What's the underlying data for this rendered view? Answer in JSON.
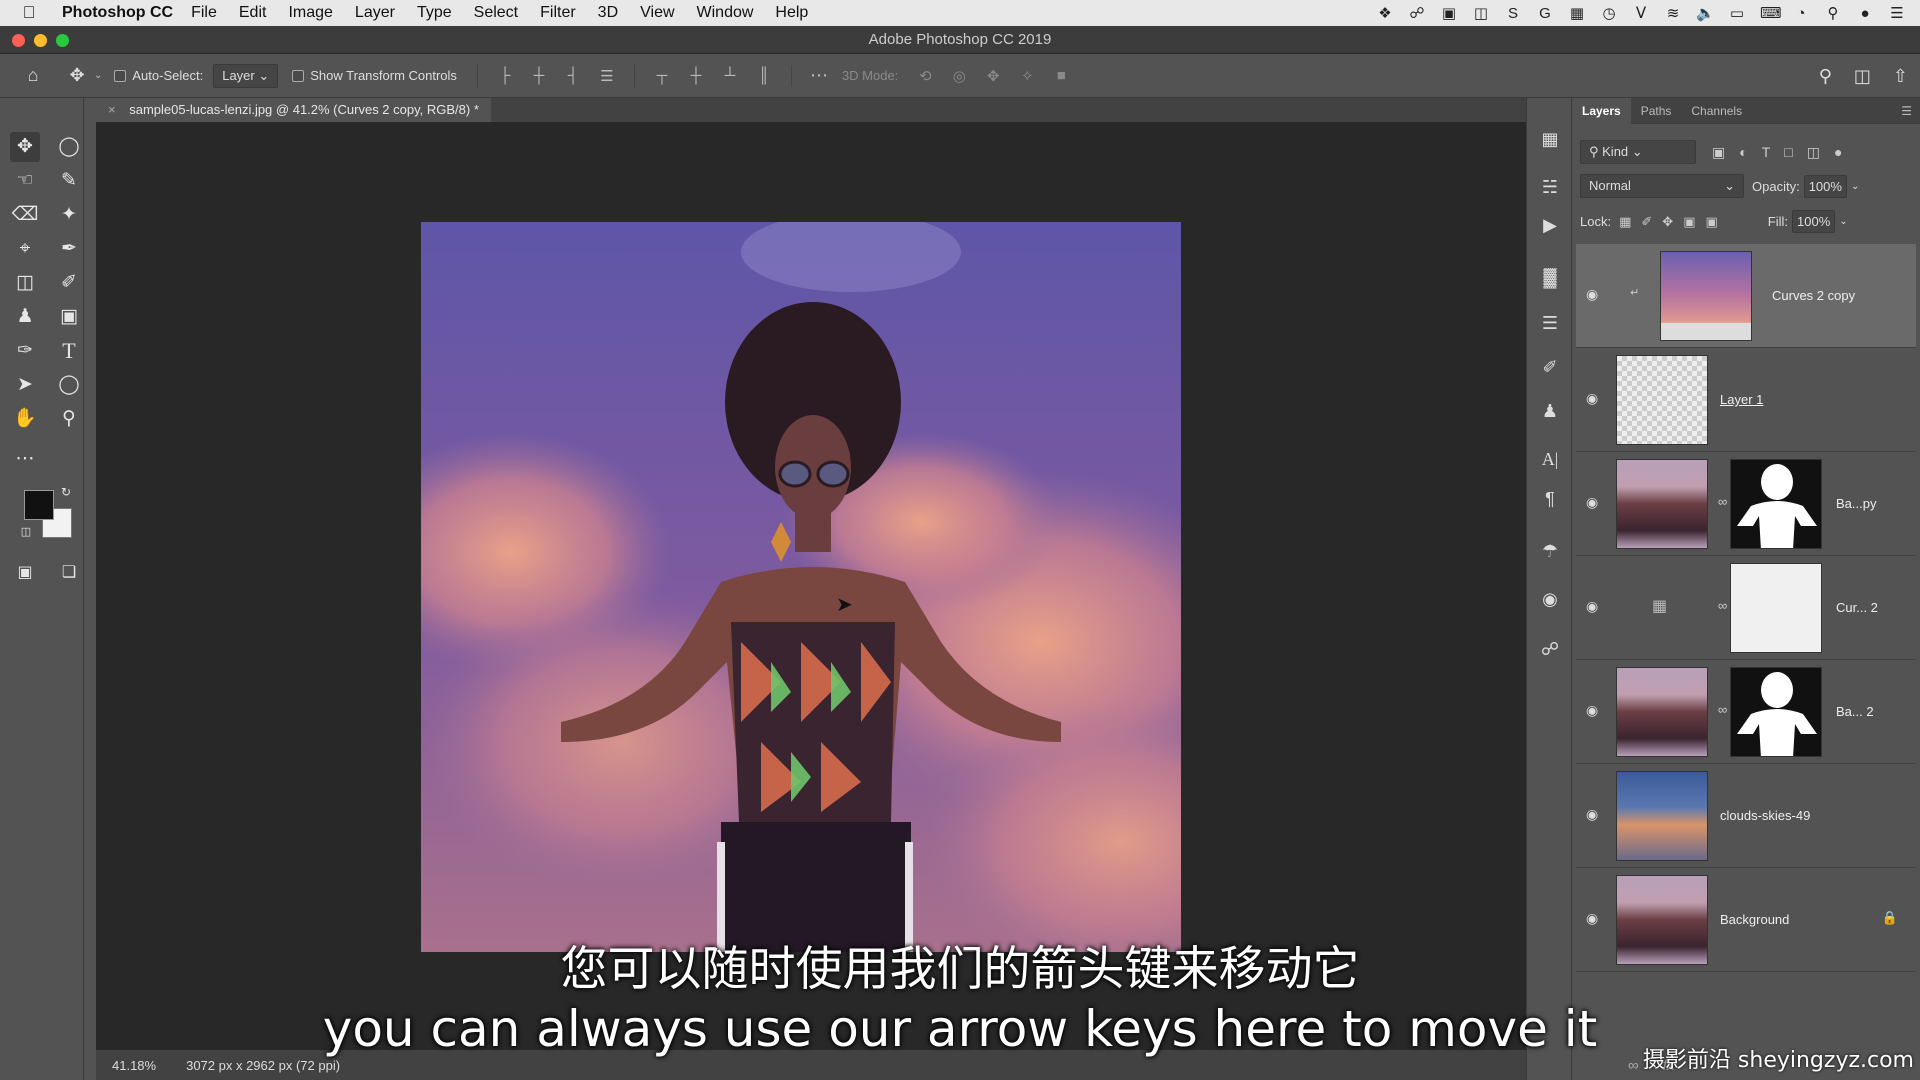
{
  "menubar": {
    "app_name": "Photoshop CC",
    "items": [
      "File",
      "Edit",
      "Image",
      "Layer",
      "Type",
      "Select",
      "Filter",
      "3D",
      "View",
      "Window",
      "Help"
    ]
  },
  "window": {
    "title": "Adobe Photoshop CC 2019"
  },
  "options": {
    "auto_select_label": "Auto-Select:",
    "auto_select_value": "Layer",
    "transform_label": "Show Transform Controls",
    "mode3d_label": "3D Mode:"
  },
  "document": {
    "tab_title": "sample05-lucas-lenzi.jpg @ 41.2% (Curves 2 copy, RGB/8) *"
  },
  "status": {
    "zoom": "41.18%",
    "doc_info": "3072 px x 2962 px (72 ppi)"
  },
  "panel": {
    "tabs": [
      "Layers",
      "Paths",
      "Channels"
    ],
    "filter_kind": "Kind",
    "blend_mode": "Normal",
    "opacity_label": "Opacity:",
    "opacity_value": "100%",
    "lock_label": "Lock:",
    "fill_label": "Fill:",
    "fill_value": "100%"
  },
  "layers": [
    {
      "name": "Curves 2 copy"
    },
    {
      "name": "Layer 1"
    },
    {
      "name": "Ba...py"
    },
    {
      "name": "Cur... 2"
    },
    {
      "name": "Ba... 2"
    },
    {
      "name": "clouds-skies-49"
    },
    {
      "name": "Background"
    }
  ],
  "subtitles": {
    "zh": "您可以随时使用我们的箭头键来移动它",
    "en": "you can always use our arrow keys here to move it"
  },
  "watermark": "摄影前沿 sheyingzyz.com",
  "colors": {
    "accent": "#535353",
    "canvas": "#282828",
    "foreground": "#111111",
    "background": "#f2f2f2"
  }
}
